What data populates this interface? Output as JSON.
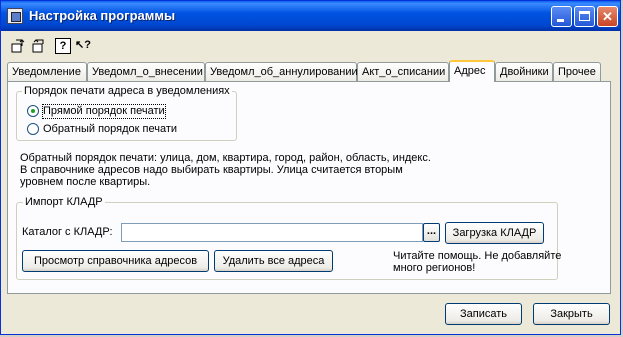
{
  "window": {
    "title": "Настройка программы"
  },
  "toolbar": {
    "icons": [
      "save-settings-icon",
      "load-settings-icon",
      "help-icon",
      "whats-this-icon"
    ],
    "glyphs": {
      "help": "?",
      "whats_this": "↖?"
    }
  },
  "tabs": [
    {
      "label": "Уведомление",
      "active": false
    },
    {
      "label": "Уведомл_о_внесении",
      "active": false
    },
    {
      "label": "Уведомл_об_аннулировании",
      "active": false
    },
    {
      "label": "Акт_о_списании",
      "active": false
    },
    {
      "label": "Адрес",
      "active": true
    },
    {
      "label": "Двойники",
      "active": false
    },
    {
      "label": "Прочее",
      "active": false
    }
  ],
  "print_order": {
    "legend": "Порядок печати адреса в уведомлениях",
    "options": [
      {
        "label": "Прямой порядок печати",
        "selected": true
      },
      {
        "label": "Обратный порядок печати",
        "selected": false
      }
    ]
  },
  "note": "Обратный порядок печати: улица, дом, квартира, город, район, область, индекс.\nВ справочнике адресов надо выбирать квартиры. Улица считается вторым\nуровнем после квартиры.",
  "kladr": {
    "legend": "Импорт КЛАДР",
    "catalog_label": "Каталог с КЛАДР:",
    "catalog_value": "",
    "browse_label": "...",
    "load_button": "Загрузка КЛАДР",
    "view_button": "Просмотр справочника адресов",
    "delete_button": "Удалить все адреса",
    "help_text": "Читайте помощь. Не добавляйте\nмного регионов!"
  },
  "footer": {
    "save_button": "Записать",
    "close_button": "Закрыть"
  },
  "colors": {
    "titlebar": "#0054e3",
    "tab_active_accent": "#ffc83c",
    "window_bg": "#ece9d8"
  }
}
